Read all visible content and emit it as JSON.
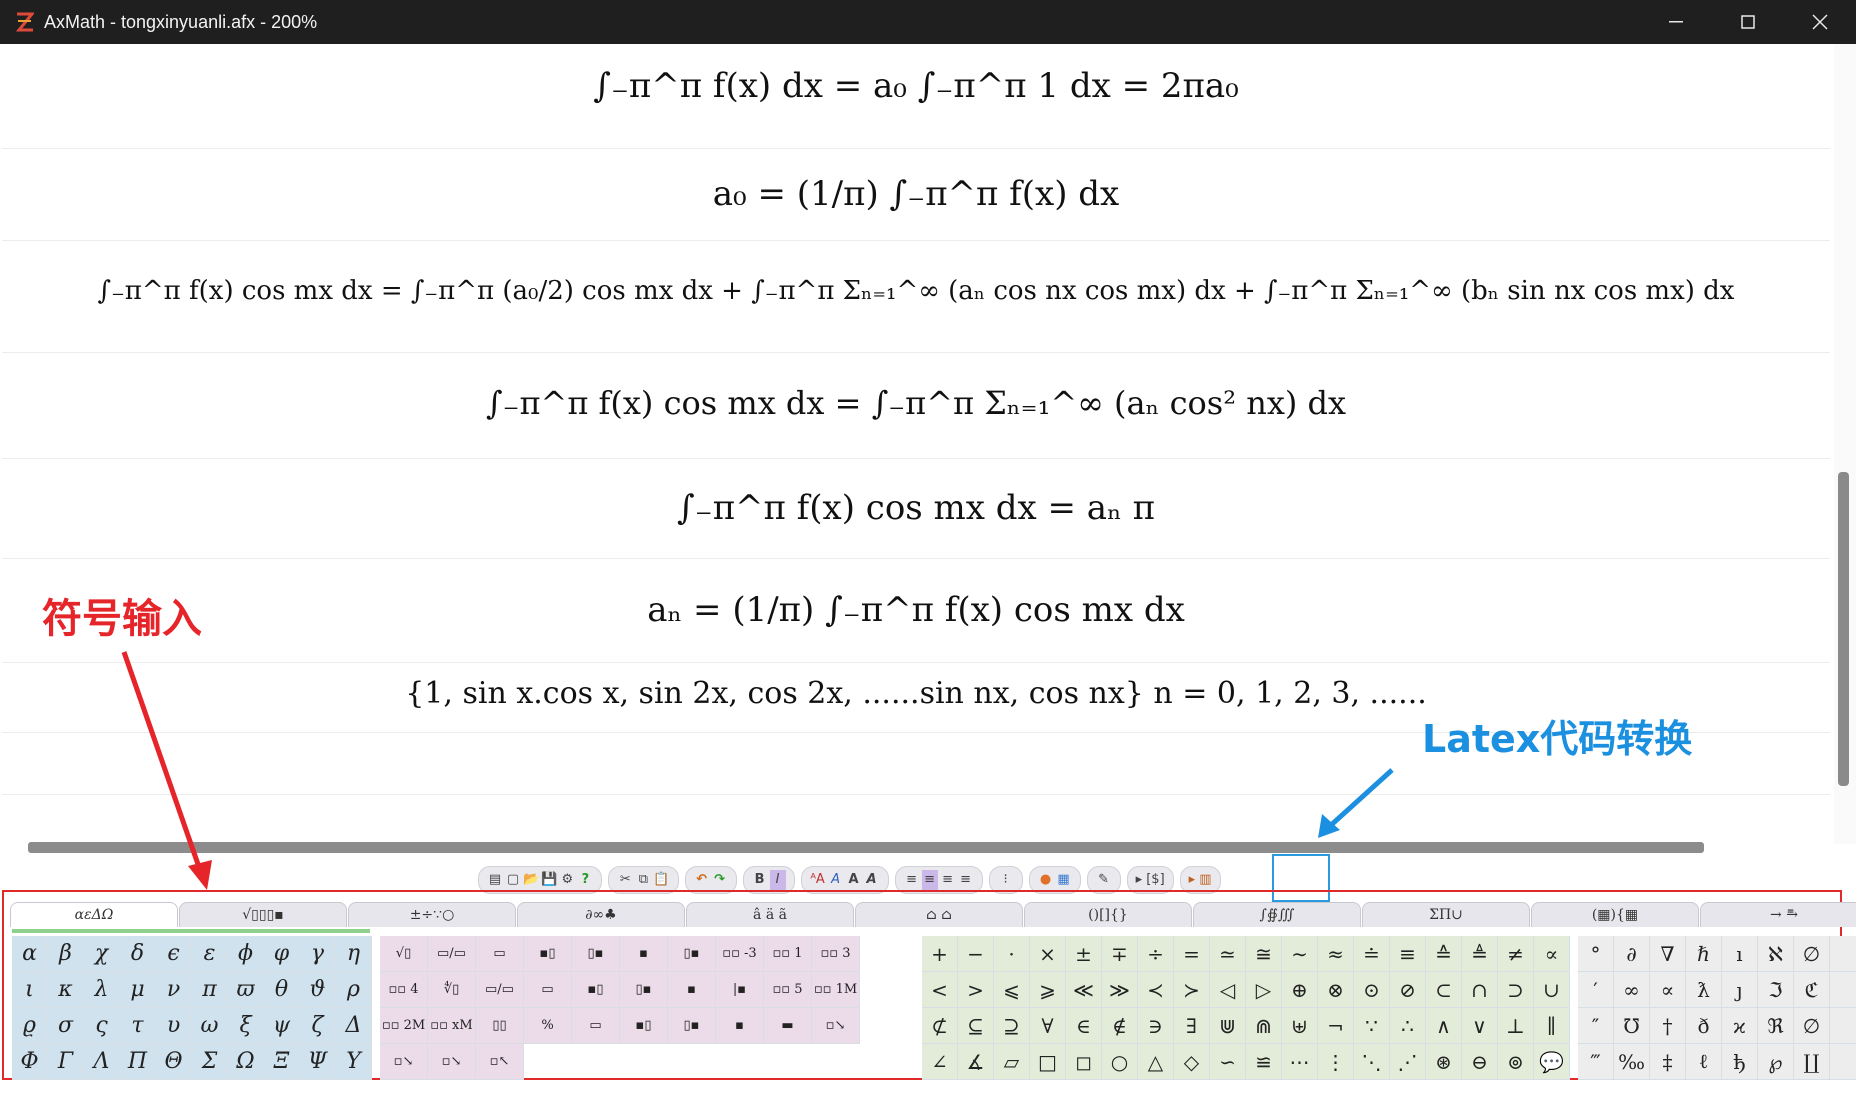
{
  "window": {
    "title": "AxMath - tongxinyuanli.afx - 200%"
  },
  "equations": [
    "∫₋π^π f(x) dx = a₀ ∫₋π^π 1 dx = 2πa₀",
    "a₀ = (1/π) ∫₋π^π f(x) dx",
    "∫₋π^π f(x) cos mx dx = ∫₋π^π (a₀/2) cos mx dx + ∫₋π^π Σₙ₌₁^∞ (aₙ cos nx cos mx) dx + ∫₋π^π Σₙ₌₁^∞ (bₙ sin nx cos mx) dx",
    "∫₋π^π f(x) cos mx dx = ∫₋π^π Σₙ₌₁^∞ (aₙ cos² nx) dx",
    "∫₋π^π f(x) cos mx dx = aₙ π",
    "aₙ = (1/π) ∫₋π^π f(x) cos mx dx",
    "{1, sin x.cos x, sin 2x, cos 2x, ......sin nx, cos nx} n = 0, 1, 2, 3, ......"
  ],
  "annotations": {
    "symbol_input": "符号输入",
    "latex_convert": "Latex代码转换"
  },
  "toolbar": {
    "groups": [
      [
        "▤",
        "▢",
        "📂",
        "💾",
        "⚙",
        "?"
      ],
      [
        "✂",
        "⧉",
        "📋"
      ],
      [
        "↶",
        "↷"
      ],
      [
        "B",
        "I"
      ],
      [
        "ᴬA",
        "A",
        "A",
        "A"
      ],
      [
        "≡",
        "≡",
        "≡",
        "≡"
      ],
      [
        "⁝"
      ],
      [
        "●",
        "▦"
      ],
      [
        "✎"
      ],
      [
        "▸ [$]"
      ],
      [
        "▸ ▥"
      ]
    ]
  },
  "tabs": [
    "αεΔΩ",
    "√▯▯▯▪",
    "±÷∵○",
    "∂∞♣",
    "â ä ã",
    "⌂ ⌂",
    "()[]{}",
    "∫∯∭",
    "ΣΠ∪",
    "(▦){▦",
    "→ ⥱"
  ],
  "greek": [
    "α",
    "β",
    "χ",
    "δ",
    "ϵ",
    "ε",
    "ϕ",
    "φ",
    "γ",
    "η",
    "ι",
    "κ",
    "λ",
    "μ",
    "ν",
    "π",
    "ϖ",
    "θ",
    "ϑ",
    "ρ",
    "ϱ",
    "σ",
    "ς",
    "τ",
    "υ",
    "ω",
    "ξ",
    "ψ",
    "ζ",
    "Δ",
    "Φ",
    "Γ",
    "Λ",
    "Π",
    "Θ",
    "Σ",
    "Ω",
    "Ξ",
    "Ψ",
    "Υ"
  ],
  "templates": [
    "√▯",
    "▭/▭",
    "▭",
    "▪▯",
    "▯▪",
    "▪",
    "▯▪",
    "▫▫ -3",
    "▫▫ 1",
    "▫▫ 3",
    "▫▫ 4",
    "∜▯",
    "▭/▭",
    "▭",
    "▪▯",
    "▯▪",
    "▪",
    "|▪",
    "▫▫ 5",
    "▫▫ 1M",
    "▫▫ 2M",
    "▫▫ xM",
    "▯▯",
    "%",
    "▭",
    "▪▯",
    "▯▪",
    "▪",
    "▬",
    "▫↘",
    "▫↘",
    "▫↘",
    "▫↖"
  ],
  "operators": [
    "+",
    "−",
    "·",
    "×",
    "±",
    "∓",
    "÷",
    "=",
    "≃",
    "≅",
    "∼",
    "≈",
    "≐",
    "≡",
    "≙",
    "≜",
    "≠",
    "∝",
    "<",
    ">",
    "⩽",
    "⩾",
    "≪",
    "≫",
    "≺",
    "≻",
    "◁",
    "▷",
    "⊕",
    "⊗",
    "⊙",
    "⊘",
    "⊂",
    "∩",
    "⊃",
    "∪",
    "⊄",
    "⊆",
    "⊇",
    "∀",
    "∈",
    "∉",
    "∋",
    "∃",
    "⋓",
    "⋒",
    "⊎",
    "¬",
    "∵",
    "∴",
    "∧",
    "∨",
    "⊥",
    "∥",
    "∠",
    "∡",
    "▱",
    "□",
    "◻",
    "○",
    "△",
    "◇",
    "∽",
    "≌",
    "⋯",
    "⋮",
    "⋱",
    "⋰",
    "⊛",
    "⊖",
    "⊚",
    "💬"
  ],
  "misc": [
    "°",
    "∂",
    "∇",
    "ℏ",
    "ı",
    "ℵ",
    "∅",
    "",
    "′",
    "∞",
    "∝",
    "ƛ",
    "ȷ",
    "ℑ",
    "ℭ",
    "",
    "″",
    "℧",
    "†",
    "ð",
    "ϰ",
    "ℜ",
    "∅",
    "",
    "‴",
    "‰",
    "‡",
    "ℓ",
    "ђ",
    "℘",
    "∐",
    ""
  ]
}
